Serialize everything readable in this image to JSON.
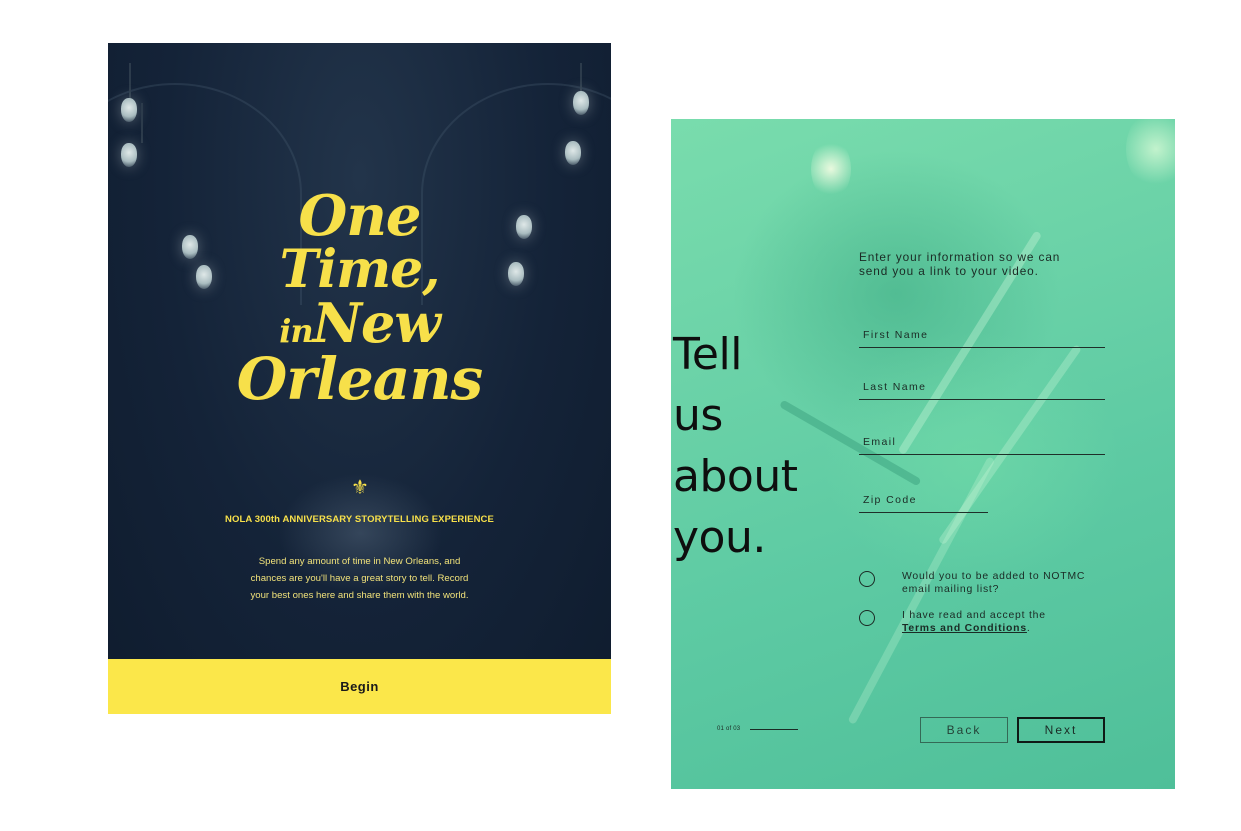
{
  "left_screen": {
    "title_lines": [
      "One",
      "Time,",
      "in",
      "New",
      "Orleans"
    ],
    "emblem_icon": "fleur-de-lis-icon",
    "subtitle": "NOLA 300th ANNIVERSARY STORYTELLING EXPERIENCE",
    "intro_lines": [
      "Spend any amount of time in New Orleans, and",
      "chances are you'll have a great story to tell. Record",
      "your best ones here and share them with the world."
    ],
    "begin_label": "Begin",
    "colors": {
      "background": "#142338",
      "accent": "#fbe74a"
    }
  },
  "right_screen": {
    "headline_lines": [
      "Tell",
      "us",
      "about",
      "you."
    ],
    "form_intro_lines": [
      "Enter your information so we can",
      "send you a link to your video."
    ],
    "fields": {
      "first_name": "First Name",
      "last_name": "Last Name",
      "email": "Email",
      "zip_code": "Zip Code"
    },
    "mailing_list_lines": [
      "Would you to be added to NOTMC",
      "email mailing list?"
    ],
    "terms_prefix": "I have read and accept the",
    "terms_link": "Terms and Conditions",
    "terms_suffix": ".",
    "pager": "01 of 03",
    "back_label": "Back",
    "next_label": "Next",
    "colors": {
      "background": "#6cd3a8",
      "text": "#1b2b25"
    }
  }
}
